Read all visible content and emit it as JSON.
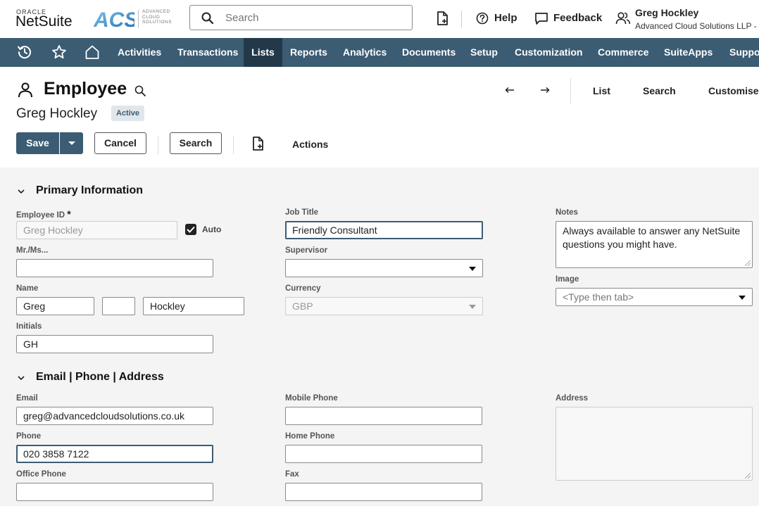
{
  "brand": {
    "oracle": "ORACLE",
    "netsuite": "NetSuite",
    "acs_mark": "ACS",
    "acs_lines": [
      "ADVANCED",
      "CLOUD",
      "SOLUTIONS"
    ],
    "accent": "#3b5c73"
  },
  "search": {
    "placeholder": "Search",
    "value": ""
  },
  "header": {
    "help": "Help",
    "feedback": "Feedback"
  },
  "user": {
    "name": "Greg Hockley",
    "company": "Advanced Cloud Solutions LLP -"
  },
  "nav": {
    "items": [
      "Activities",
      "Transactions",
      "Lists",
      "Reports",
      "Analytics",
      "Documents",
      "Setup",
      "Customization",
      "Commerce",
      "SuiteApps",
      "Support"
    ],
    "active": "Lists"
  },
  "record": {
    "type": "Employee",
    "name": "Greg Hockley",
    "status": "Active",
    "links": {
      "list": "List",
      "search": "Search",
      "customise": "Customise"
    }
  },
  "toolbar": {
    "save": "Save",
    "cancel": "Cancel",
    "search": "Search",
    "actions": "Actions"
  },
  "primary": {
    "title": "Primary Information",
    "employee_id": {
      "label": "Employee ID",
      "required_mark": "*",
      "value": "Greg Hockley",
      "auto_label": "Auto",
      "auto_checked": true
    },
    "salutation": {
      "label": "Mr./Ms...",
      "value": ""
    },
    "name": {
      "label": "Name",
      "first": "Greg",
      "middle": "",
      "last": "Hockley"
    },
    "initials": {
      "label": "Initials",
      "value": "GH"
    },
    "job_title": {
      "label": "Job Title",
      "value": "Friendly Consultant"
    },
    "supervisor": {
      "label": "Supervisor",
      "value": ""
    },
    "currency": {
      "label": "Currency",
      "value": "GBP"
    },
    "notes": {
      "label": "Notes",
      "value": "Always available to answer any NetSuite questions you might have."
    },
    "image": {
      "label": "Image",
      "placeholder": "<Type then tab>"
    }
  },
  "contact": {
    "title": "Email | Phone | Address",
    "email": {
      "label": "Email",
      "value": "greg@advancedcloudsolutions.co.uk"
    },
    "phone": {
      "label": "Phone",
      "value": "020 3858 7122"
    },
    "office_phone": {
      "label": "Office Phone",
      "value": ""
    },
    "mobile_phone": {
      "label": "Mobile Phone",
      "value": ""
    },
    "home_phone": {
      "label": "Home Phone",
      "value": ""
    },
    "fax": {
      "label": "Fax",
      "value": ""
    },
    "address": {
      "label": "Address",
      "value": ""
    }
  }
}
